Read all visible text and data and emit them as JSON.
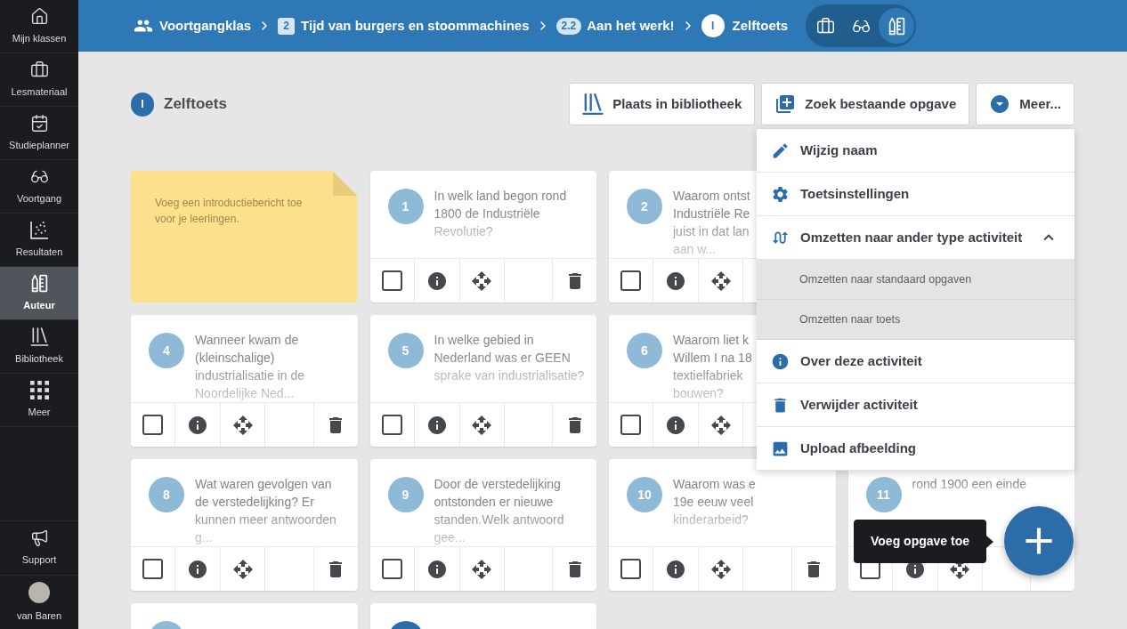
{
  "sidebar": {
    "items": [
      {
        "label": "Mijn klassen",
        "selected": false
      },
      {
        "label": "Lesmateriaal",
        "selected": false
      },
      {
        "label": "Studieplanner",
        "selected": false
      },
      {
        "label": "Voortgang",
        "selected": false
      },
      {
        "label": "Resultaten",
        "selected": false
      },
      {
        "label": "Auteur",
        "selected": true
      },
      {
        "label": "Bibliotheek",
        "selected": false
      },
      {
        "label": "Meer",
        "selected": false
      }
    ],
    "footer_items": [
      {
        "label": "Support"
      },
      {
        "label": "van Baren"
      }
    ]
  },
  "breadcrumb": [
    {
      "kind": "class",
      "label": "Voortgangklas"
    },
    {
      "kind": "chapter",
      "badge": "2",
      "label": "Tijd van burgers en stoommachines"
    },
    {
      "kind": "section",
      "badge": "2.2",
      "label": "Aan het werk!"
    },
    {
      "kind": "current",
      "badge": "I",
      "label": "Zelftoets"
    }
  ],
  "view_switch": [
    {
      "selected": false
    },
    {
      "selected": false
    },
    {
      "selected": true
    }
  ],
  "header": {
    "badge": "I",
    "title": "Zelftoets"
  },
  "toolbar": [
    {
      "label": "Plaats in bibliotheek"
    },
    {
      "label": "Zoek bestaande opgave"
    },
    {
      "label": "Meer..."
    }
  ],
  "menu": {
    "items": [
      {
        "label": "Wijzig naam"
      },
      {
        "label": "Toetsinstellingen"
      },
      {
        "label": "Omzetten naar ander type activiteit",
        "expanded": true,
        "children": [
          {
            "label": "Omzetten naar standaard opgaven"
          },
          {
            "label": "Omzetten naar toets"
          }
        ]
      },
      {
        "label": "Over deze activiteit"
      },
      {
        "label": "Verwijder activiteit"
      },
      {
        "label": "Upload afbeelding"
      }
    ]
  },
  "card_rows": [
    [
      {
        "kind": "note",
        "text": "Voeg een introductiebericht toe voor je leerlingen."
      },
      {
        "kind": "question",
        "number": "1",
        "color": "#8ebad7",
        "text": "In welk land begon rond 1800 de Industriële Revolutie?",
        "checked": false
      },
      {
        "kind": "question",
        "number": "2",
        "color": "#8ebad7",
        "text": "Waarom ontst\nIndustriële Re\njuist in dat lan\naan w...",
        "checked": false
      }
    ],
    [
      {
        "kind": "question",
        "number": "4",
        "color": "#8ebad7",
        "text": "Wanneer kwam de (kleinschalige) industrialisatie in de Noordelijke Ned...",
        "checked": false
      },
      {
        "kind": "question",
        "number": "5",
        "color": "#8ebad7",
        "text": "In welke gebied in Nederland was er GEEN sprake van industrialisatie?",
        "checked": false
      },
      {
        "kind": "question",
        "number": "6",
        "color": "#8ebad7",
        "text": "Waarom liet k\nWillem I na 18\ntextielfabriek\nbouwen?",
        "checked": false
      }
    ],
    [
      {
        "kind": "question",
        "number": "8",
        "color": "#8ebad7",
        "text": "Wat waren gevolgen van de verstedelijking? Er kunnen meer antwoorden g...",
        "checked": false
      },
      {
        "kind": "question",
        "number": "9",
        "color": "#8ebad7",
        "text": "Door de verstedelijking ontstonden er nieuwe standen.Welk antwoord gee...",
        "checked": false
      },
      {
        "kind": "question",
        "number": "10",
        "color": "#8ebad7",
        "text": "Waarom was e\n19e eeuw veel\nkinderarbeid?",
        "checked": false
      },
      {
        "kind": "question",
        "number": "11",
        "color": "#8ebad7",
        "text": "rond 1900 een einde",
        "overlaid": true,
        "checked": false
      }
    ],
    [
      {
        "kind": "question",
        "color": "#8ebad7"
      },
      {
        "kind": "question",
        "color": "#2c6da9"
      }
    ]
  ],
  "tooltip": "Voeg opgave toe"
}
